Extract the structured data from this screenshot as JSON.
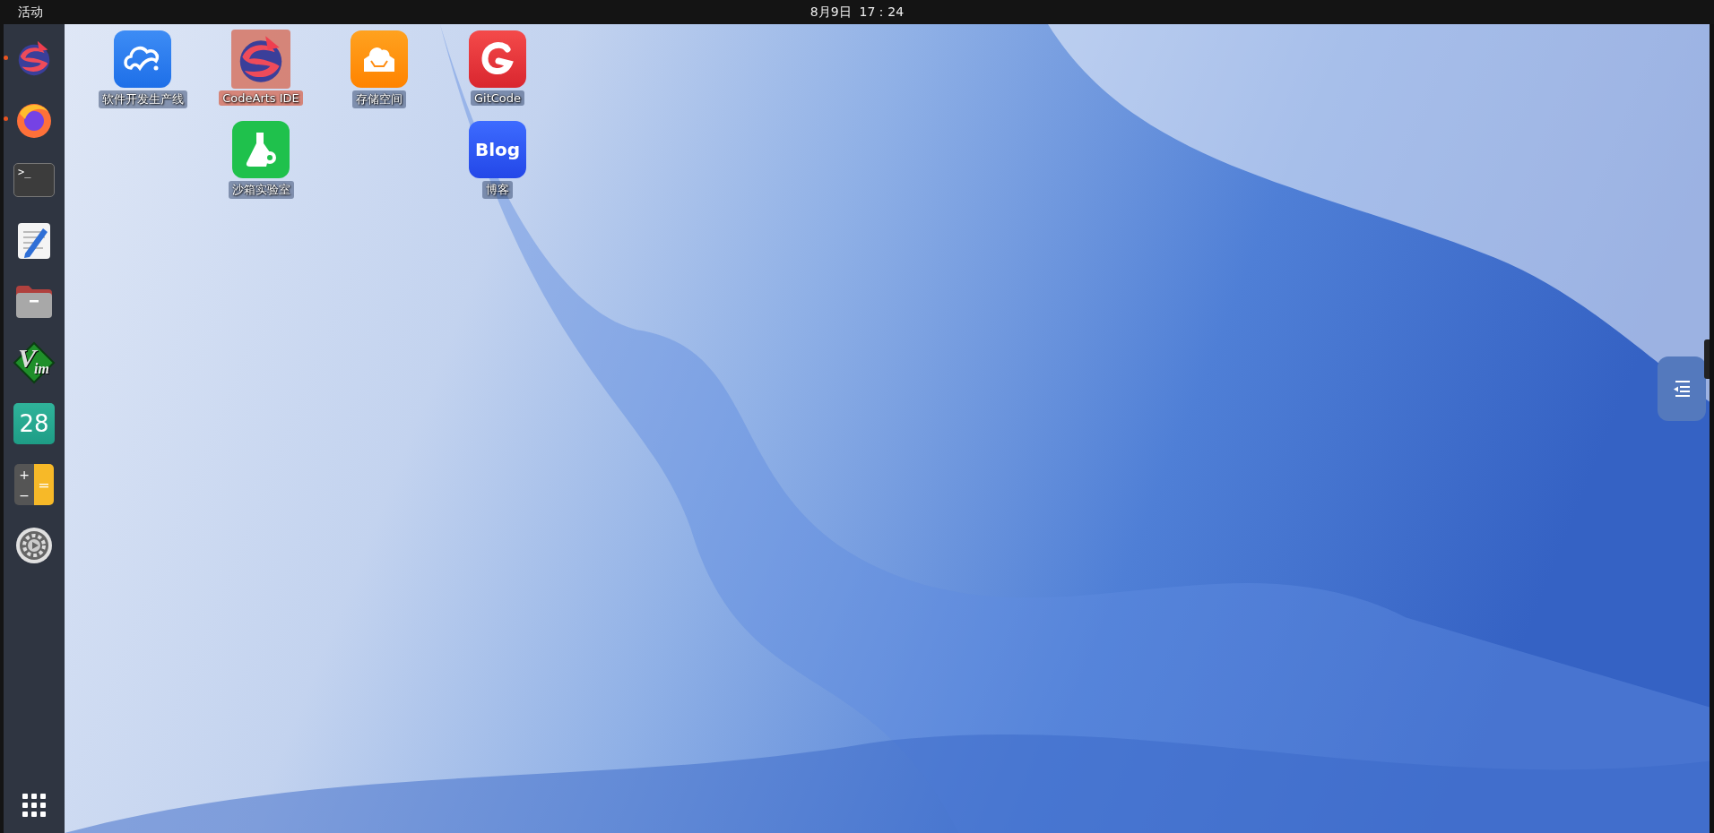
{
  "top_bar": {
    "activities": "活动",
    "clock": "8月9日  17：24"
  },
  "dock": {
    "items": [
      {
        "kind": "swirl",
        "running": true
      },
      {
        "kind": "firefox",
        "running": true
      },
      {
        "kind": "terminal",
        "running": false,
        "glyph": ">_"
      },
      {
        "kind": "editor",
        "running": false
      },
      {
        "kind": "files",
        "running": false
      },
      {
        "kind": "vim",
        "running": false,
        "glyph": "V",
        "glyph_2": "im"
      },
      {
        "kind": "calendar",
        "running": false,
        "glyph": "28"
      },
      {
        "kind": "calculator",
        "running": false,
        "glyph": "+",
        "glyph_2": "−",
        "glyph_3": "="
      },
      {
        "kind": "settings",
        "running": false
      }
    ]
  },
  "desktop_columns": [
    {
      "icons": [
        {
          "kind": "cloud",
          "label": "软件开发生产线",
          "selected": false
        }
      ]
    },
    {
      "icons": [
        {
          "kind": "swirl",
          "label": "CodeArts IDE",
          "selected": true
        },
        {
          "kind": "flask",
          "label": "沙箱实验室",
          "selected": false
        }
      ]
    },
    {
      "icons": [
        {
          "kind": "storage",
          "label": "存储空间",
          "selected": false
        }
      ]
    },
    {
      "icons": [
        {
          "kind": "gitcode",
          "label": "GitCode",
          "selected": false
        },
        {
          "kind": "blog",
          "label": "博客",
          "selected": false,
          "glyph": "Blog"
        }
      ]
    }
  ]
}
